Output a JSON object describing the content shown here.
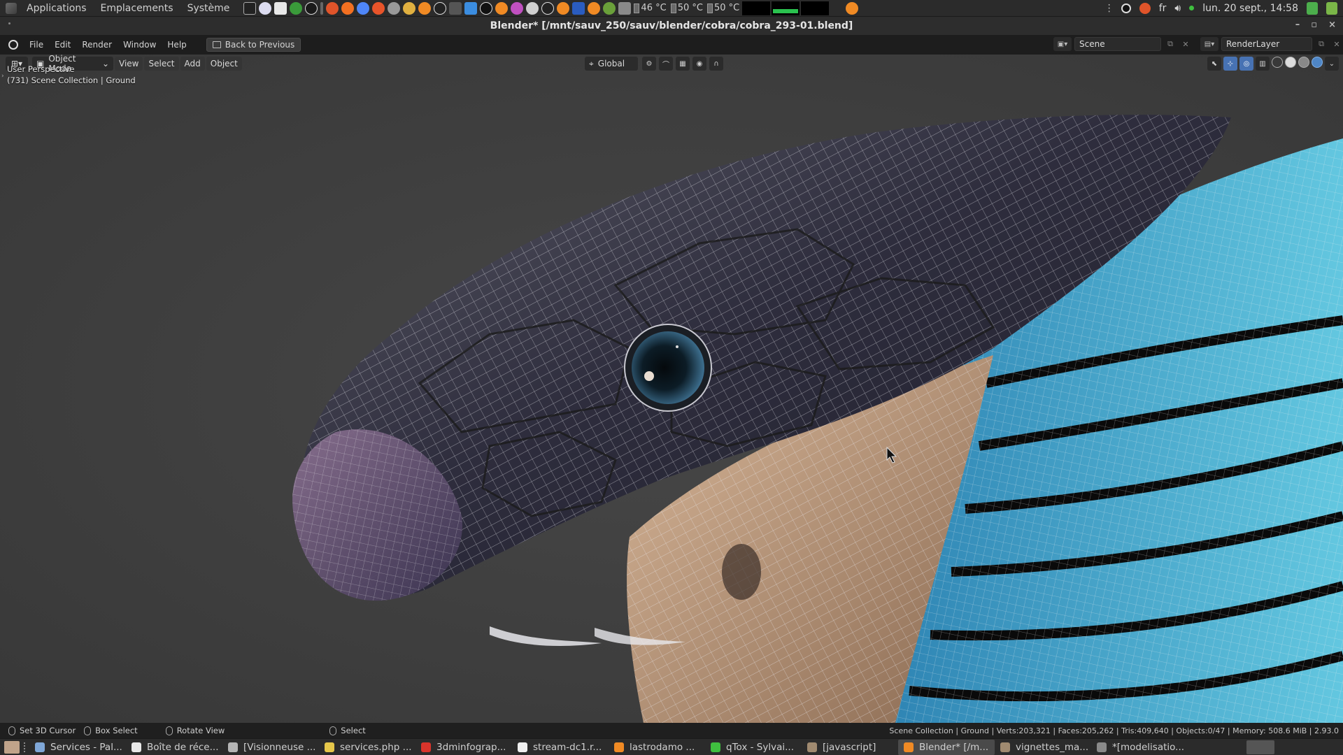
{
  "top_panel": {
    "menus": [
      "Applications",
      "Emplacements",
      "Système"
    ],
    "temps": [
      "46 °C",
      "50 °C",
      "50 °C"
    ],
    "keyboard_layout": "fr",
    "datetime": "lun. 20 sept., 14:58"
  },
  "window": {
    "title": "Blender* [/mnt/sauv_250/sauv/blender/cobra/cobra_293-01.blend]",
    "controls": [
      "–",
      "▫",
      "×"
    ]
  },
  "blender_menu": {
    "items": [
      "File",
      "Edit",
      "Render",
      "Window",
      "Help"
    ],
    "back_button": "Back to Previous",
    "scene": "Scene",
    "render_layer": "RenderLayer"
  },
  "viewport_header": {
    "mode": "Object Mode",
    "menus": [
      "View",
      "Select",
      "Add",
      "Object"
    ],
    "transform_orientation": "Global"
  },
  "viewport": {
    "perspective_label": "User Perspective",
    "collection_label": "(731) Scene Collection | Ground"
  },
  "status_bar": {
    "items": [
      "Set 3D Cursor",
      "Box Select",
      "Rotate View",
      "Select"
    ],
    "stats": "Scene Collection | Ground | Verts:203,321 | Faces:205,262 | Tris:409,640 | Objects:0/47 | Memory: 508.6 MiB | 2.93.0"
  },
  "taskbar": {
    "tasks": [
      {
        "label": "Services - Pal...",
        "color": "#7fa7d8"
      },
      {
        "label": "Boîte de réce...",
        "color": "#e8e8e8"
      },
      {
        "label": "[Visionneuse ...",
        "color": "#b5b5b5"
      },
      {
        "label": "services.php ...",
        "color": "#e6c74a"
      },
      {
        "label": "3dminfograp...",
        "color": "#d9342b"
      },
      {
        "label": "stream-dc1.r...",
        "color": "#f0f0f0"
      },
      {
        "label": "lastrodamo ...",
        "color": "#f08a24"
      },
      {
        "label": "qTox - Sylvai...",
        "color": "#3fbf3f"
      },
      {
        "label": "[javascript]",
        "color": "#a08a70"
      },
      {
        "label": "Blender* [/m...",
        "color": "#f08a24"
      },
      {
        "label": "vignettes_ma...",
        "color": "#a08a70"
      },
      {
        "label": "*[modelisatio...",
        "color": "#8a8a8a"
      }
    ],
    "active_index": 9
  }
}
